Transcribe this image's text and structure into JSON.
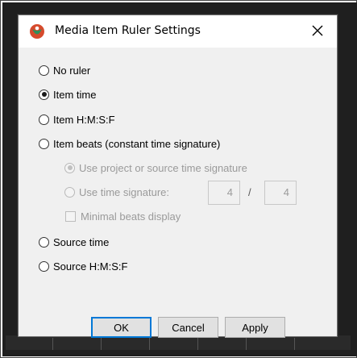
{
  "dialog": {
    "title": "Media Item Ruler Settings",
    "close_label": "✕"
  },
  "options": {
    "no_ruler": {
      "label": "No ruler",
      "checked": false
    },
    "item_time": {
      "label": "Item time",
      "checked": true
    },
    "item_hmsf": {
      "label": "Item H:M:S:F",
      "checked": false
    },
    "item_beats": {
      "label": "Item beats (constant time signature)",
      "checked": false
    },
    "source_time": {
      "label": "Source time",
      "checked": false
    },
    "source_hmsf": {
      "label": "Source H:M:S:F",
      "checked": false
    }
  },
  "beats_sub": {
    "use_project": {
      "label": "Use project or source time signature",
      "checked": true,
      "enabled": false
    },
    "use_time_sig": {
      "label": "Use time signature:",
      "checked": false,
      "enabled": false
    },
    "numerator": "4",
    "separator": "/",
    "denominator": "4",
    "minimal_beats": {
      "label": "Minimal beats display",
      "checked": false,
      "enabled": false
    }
  },
  "buttons": {
    "ok": "OK",
    "cancel": "Cancel",
    "apply": "Apply"
  },
  "colors": {
    "dialog_bg": "#f0f0f0",
    "titlebar_bg": "#ffffff",
    "default_button_border": "#0078d7",
    "disabled_text": "#9a9a9a",
    "icon_red": "#d64a2c",
    "icon_green": "#2f8f5b"
  },
  "icons": {
    "app": "reaper-app-icon",
    "close": "close-icon"
  }
}
